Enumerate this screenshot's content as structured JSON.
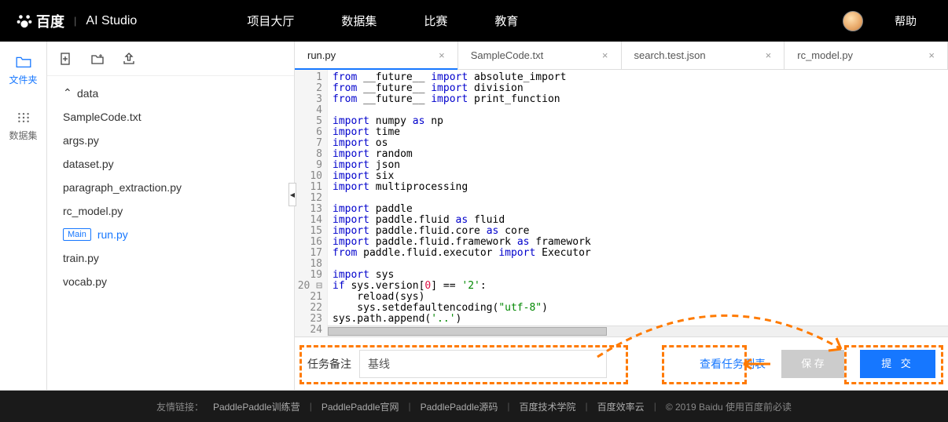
{
  "header": {
    "logo_text": "百度",
    "logo_studio": "AI Studio",
    "nav": [
      "项目大厅",
      "数据集",
      "比赛",
      "教育"
    ],
    "help": "帮助"
  },
  "left_rail": {
    "files_label": "文件夹",
    "datasets_label": "数据集"
  },
  "file_tree": {
    "folder": "data",
    "files": [
      "SampleCode.txt",
      "args.py",
      "dataset.py",
      "paragraph_extraction.py",
      "rc_model.py",
      "run.py",
      "train.py",
      "vocab.py"
    ],
    "main_file_index": 5,
    "main_badge": "Main"
  },
  "tabs": [
    {
      "label": "run.py",
      "active": true
    },
    {
      "label": "SampleCode.txt",
      "active": false
    },
    {
      "label": "search.test.json",
      "active": false
    },
    {
      "label": "rc_model.py",
      "active": false
    }
  ],
  "code": {
    "start": 1,
    "lines": [
      [
        [
          "kw",
          "from"
        ],
        [
          "",
          " __future__ "
        ],
        [
          "kw",
          "import"
        ],
        [
          "",
          " absolute_import"
        ]
      ],
      [
        [
          "kw",
          "from"
        ],
        [
          "",
          " __future__ "
        ],
        [
          "kw",
          "import"
        ],
        [
          "",
          " division"
        ]
      ],
      [
        [
          "kw",
          "from"
        ],
        [
          "",
          " __future__ "
        ],
        [
          "kw",
          "import"
        ],
        [
          "",
          " print_function"
        ]
      ],
      [],
      [
        [
          "kw",
          "import"
        ],
        [
          "",
          " numpy "
        ],
        [
          "kw",
          "as"
        ],
        [
          "",
          " np"
        ]
      ],
      [
        [
          "kw",
          "import"
        ],
        [
          "",
          " time"
        ]
      ],
      [
        [
          "kw",
          "import"
        ],
        [
          "",
          " os"
        ]
      ],
      [
        [
          "kw",
          "import"
        ],
        [
          "",
          " random"
        ]
      ],
      [
        [
          "kw",
          "import"
        ],
        [
          "",
          " json"
        ]
      ],
      [
        [
          "kw",
          "import"
        ],
        [
          "",
          " six"
        ]
      ],
      [
        [
          "kw",
          "import"
        ],
        [
          "",
          " multiprocessing"
        ]
      ],
      [],
      [
        [
          "kw",
          "import"
        ],
        [
          "",
          " paddle"
        ]
      ],
      [
        [
          "kw",
          "import"
        ],
        [
          "",
          " paddle.fluid "
        ],
        [
          "kw",
          "as"
        ],
        [
          "",
          " fluid"
        ]
      ],
      [
        [
          "kw",
          "import"
        ],
        [
          "",
          " paddle.fluid.core "
        ],
        [
          "kw",
          "as"
        ],
        [
          "",
          " core"
        ]
      ],
      [
        [
          "kw",
          "import"
        ],
        [
          "",
          " paddle.fluid.framework "
        ],
        [
          "kw",
          "as"
        ],
        [
          "",
          " framework"
        ]
      ],
      [
        [
          "kw",
          "from"
        ],
        [
          "",
          " paddle.fluid.executor "
        ],
        [
          "kw",
          "import"
        ],
        [
          "",
          " Executor"
        ]
      ],
      [],
      [
        [
          "kw",
          "import"
        ],
        [
          "",
          " sys"
        ]
      ],
      [
        [
          "kw",
          "if"
        ],
        [
          "",
          " sys.version["
        ],
        [
          "num",
          "0"
        ],
        [
          "",
          "] == "
        ],
        [
          "str",
          "'2'"
        ],
        [
          "",
          ":"
        ]
      ],
      [
        [
          "",
          "    reload(sys)"
        ]
      ],
      [
        [
          "",
          "    sys.setdefaultencoding("
        ],
        [
          "str",
          "\"utf-8\""
        ],
        [
          "",
          ")"
        ]
      ],
      [
        [
          "",
          "sys.path.append("
        ],
        [
          "str",
          "'..'"
        ],
        [
          "",
          ")"
        ]
      ],
      []
    ]
  },
  "task_bar": {
    "label": "任务备注",
    "input_value": "基线",
    "view_list": "查看任务列表",
    "save": "保 存",
    "submit": "提 交"
  },
  "footer": {
    "prefix": "友情链接：",
    "links": [
      "PaddlePaddle训练营",
      "PaddlePaddle官网",
      "PaddlePaddle源码",
      "百度技术学院",
      "百度效率云"
    ],
    "copyright": "© 2019 Baidu 使用百度前必读"
  }
}
